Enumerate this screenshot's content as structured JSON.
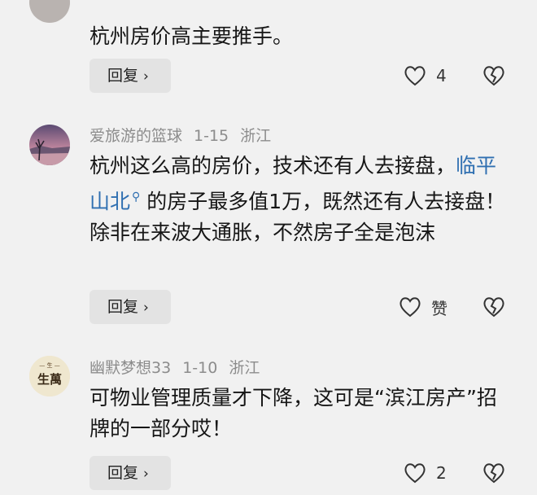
{
  "comments": [
    {
      "text": "杭州房价高主要推手。",
      "reply_label": "回复",
      "like_count": "4"
    },
    {
      "username": "爱旅游的篮球",
      "date": "1-15",
      "location": "浙江",
      "text_before": "杭州这么高的房价，技术还有人去接盘，",
      "tag": "临平山北",
      "text_after": "的房子最多值1万，既然还有人去接盘！除非在来波大通胀，不然房子全是泡沫",
      "reply_label": "回复",
      "like_count": "赞"
    },
    {
      "username": "幽默梦想33",
      "date": "1-10",
      "location": "浙江",
      "avatar_text": "生萬",
      "text": "可物业管理质量才下降，这可是“滨江房产”招牌的一部分哎！",
      "reply_label": "回复",
      "like_count": "2"
    }
  ],
  "colors": {
    "background": "#f1f1f1",
    "meta_text": "#8c8c8c",
    "tag_blue": "#2f6fb1",
    "reply_bg": "#e3e3e3"
  },
  "icons": [
    "heart-outline-icon",
    "broken-heart-icon",
    "chevron-right-icon",
    "search-tag-icon"
  ]
}
